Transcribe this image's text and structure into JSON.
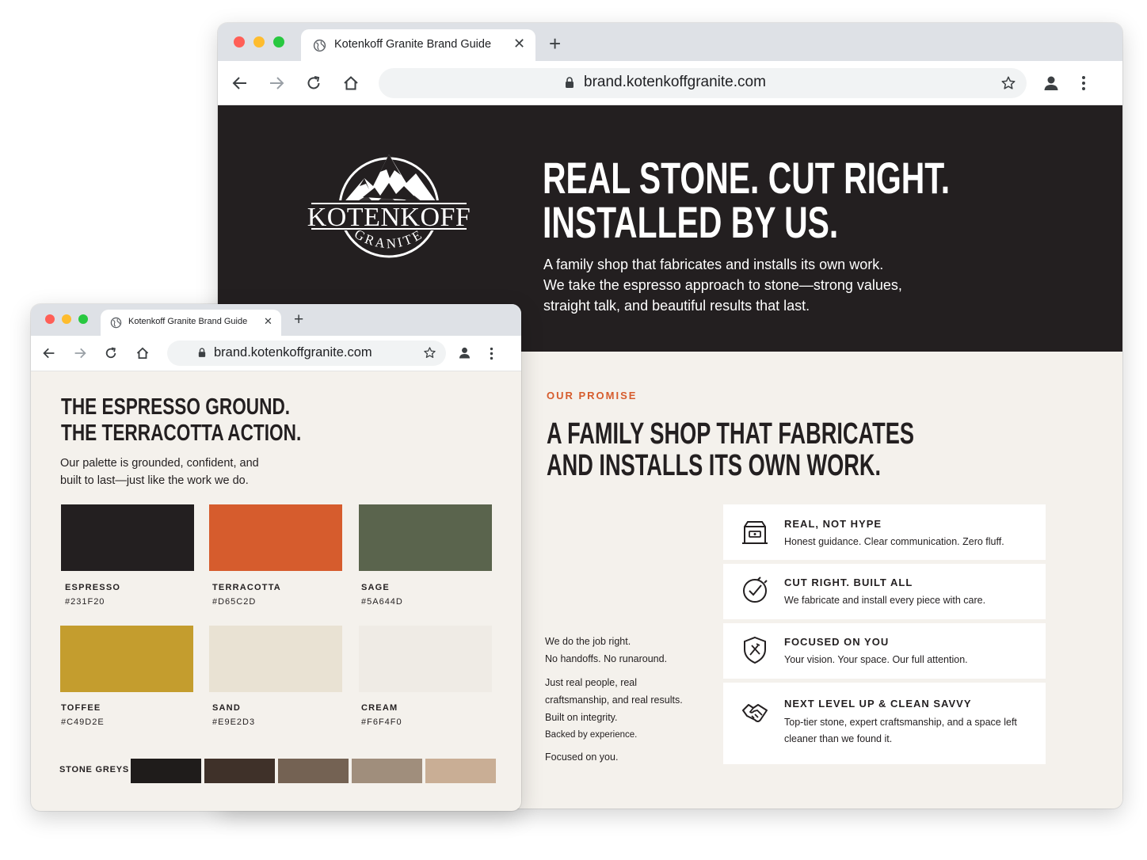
{
  "colors": {
    "espresso": "#231F20",
    "terracotta": "#D65C2D",
    "sage": "#5A644D",
    "toffee": "#C49D2E",
    "sand": "#E9E2D3",
    "cream": "#F6F4F0",
    "window_close": "#ff5f57",
    "window_min": "#febc2e",
    "window_max": "#28c840"
  },
  "back_window": {
    "tab_title": "Kotenkoff Granite Brand Guide",
    "url": "brand.kotenkoffgranite.com",
    "hero": {
      "logo_name": "KOTENKOFF",
      "logo_sub": "GRANITE",
      "headline_line1": "REAL STONE. CUT RIGHT.",
      "headline_line2": "INSTALLED BY US.",
      "body_line1": "A family shop that fabricates and installs its own work.",
      "body_line2": "We take the espresso approach to stone—strong values,",
      "body_line3": "straight talk, and beautiful results that last."
    },
    "promise": {
      "eyebrow": "OUR PROMISE",
      "headline_line1": "A FAMILY SHOP THAT FABRICATES",
      "headline_line2": "AND INSTALLS ITS OWN WORK.",
      "left_copy": [
        "We do the job right.",
        "No handoffs. No runaround.",
        "Just real people, real",
        "craftsmanship, and real results.",
        "Built on integrity.",
        "Backed by experience.",
        "Focused on you."
      ],
      "cards": [
        {
          "icon": "store-icon",
          "title": "REAL, NOT HYPE",
          "desc": "Honest guidance. Clear communication. Zero fluff."
        },
        {
          "icon": "check-cut-icon",
          "title": "CUT RIGHT. BUILT ALL",
          "desc": "We fabricate and install every piece with care."
        },
        {
          "icon": "shield-tools-icon",
          "title": "FOCUSED ON YOU",
          "desc": "Your vision. Your space. Our full attention."
        },
        {
          "icon": "handshake-icon",
          "title": "NEXT LEVEL UP & CLEAN SAVVY",
          "desc": "Top-tier stone, expert craftsmanship, and a space left cleaner than we found it."
        }
      ]
    }
  },
  "front_window": {
    "tab_title": "Kotenkoff Granite Brand Guide",
    "url": "brand.kotenkoffgranite.com",
    "headline_line1": "THE ESPRESSO GROUND.",
    "headline_line2": "THE TERRACOTTA ACTION.",
    "body_line1": "Our palette is grounded, confident, and",
    "body_line2": "built to last—just like the work we do.",
    "swatches": [
      {
        "name": "ESPRESSO",
        "hex": "#231F20"
      },
      {
        "name": "TERRACOTTA",
        "hex": "#D65C2D"
      },
      {
        "name": "SAGE",
        "hex": "#5A644D"
      },
      {
        "name": "TOFFEE",
        "hex": "#C49D2E"
      },
      {
        "name": "SAND",
        "hex": "#E9E2D3"
      },
      {
        "name": "CREAM",
        "hex": "#F6F4F0"
      }
    ],
    "stone_greys_label": "STONE GREYS",
    "stone_greys": [
      "#1f1c1b",
      "#3f3129",
      "#746253",
      "#a08e7c",
      "#c9ae95"
    ]
  }
}
